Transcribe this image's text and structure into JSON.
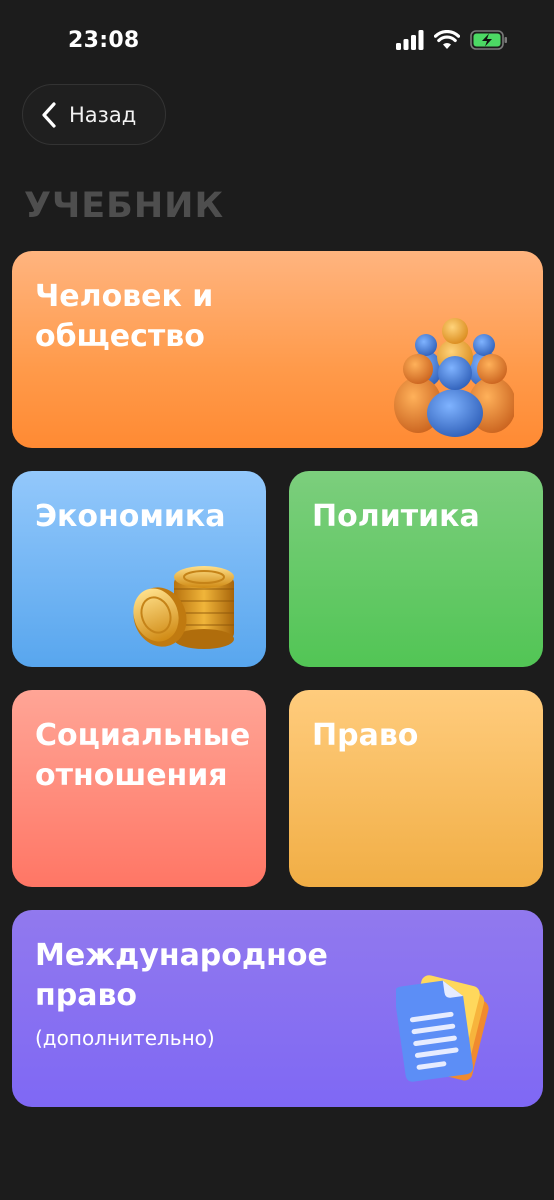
{
  "status_bar": {
    "time": "23:08",
    "icons": [
      "signal-icon",
      "wifi-icon",
      "battery-charging-icon"
    ]
  },
  "nav": {
    "back_label": "Назад"
  },
  "page": {
    "section_title": "УЧЕБНИК"
  },
  "cards": [
    {
      "id": "society",
      "title": "Человек и\nобщество",
      "icon": "people-group-icon",
      "color": "#ff9a4a"
    },
    {
      "id": "economy",
      "title": "Экономика",
      "icon": "coins-icon",
      "color": "#58a6ee"
    },
    {
      "id": "politics",
      "title": "Политика",
      "color": "#52c555"
    },
    {
      "id": "social",
      "title": "Социальные\nотношения",
      "color": "#ff7665"
    },
    {
      "id": "law",
      "title": "Право",
      "color": "#f1ae45"
    },
    {
      "id": "intl",
      "title": "Международное\nправо",
      "subtitle": "(дополнительно)",
      "icon": "documents-icon",
      "color": "#7f68f4"
    }
  ]
}
